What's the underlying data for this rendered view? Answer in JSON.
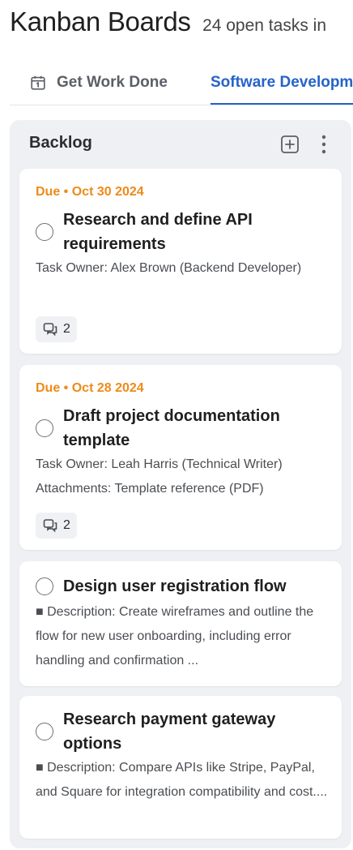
{
  "header": {
    "title": "Kanban Boards",
    "open_count": "24 open tasks in"
  },
  "tabs": [
    {
      "label": "Get Work Done",
      "icon": "calendar-icon",
      "active": false
    },
    {
      "label": "Software Development",
      "active": true
    }
  ],
  "colors": {
    "accent": "#2563c9",
    "due": "#ee8a1a",
    "column_bg": "#eef0f3"
  },
  "column": {
    "title": "Backlog",
    "cards": [
      {
        "due": "Due • Oct 30 2024",
        "title": "Research and define API requirements",
        "meta_lines": [
          "Task Owner: Alex Brown (Backend Developer)"
        ],
        "comments": "2"
      },
      {
        "due": "Due • Oct 28 2024",
        "title": "Draft project documentation template",
        "meta_lines": [
          "Task Owner: Leah Harris (Technical Writer)",
          "Attachments: Template reference (PDF)"
        ],
        "comments": "2"
      },
      {
        "title": "Design user registration flow",
        "description": "■ Description: Create wireframes and outline the flow for new user onboarding, including error handling and confirmation ..."
      },
      {
        "title": "Research payment gateway options",
        "description": "■ Description: Compare APIs like Stripe, PayPal, and Square for integration compatibility and cost...."
      }
    ]
  }
}
